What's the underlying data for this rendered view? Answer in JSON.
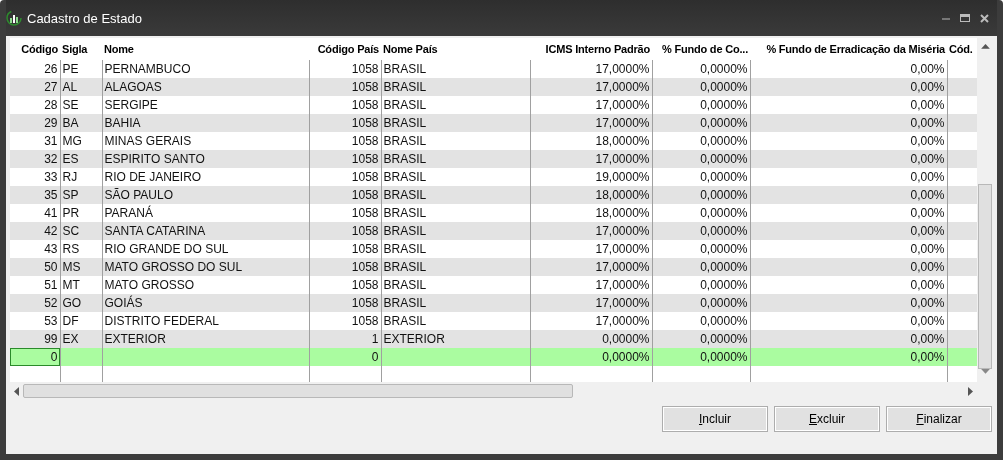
{
  "window": {
    "title": "Cadastro de Estado"
  },
  "table": {
    "columns": [
      "Código",
      "Sigla",
      "Nome",
      "Código País",
      "Nome País",
      "ICMS Interno Padrão",
      "% Fundo de Co...",
      "% Fundo de Erradicação da Miséria",
      "Cód."
    ],
    "rows": [
      {
        "cells": [
          "26",
          "PE",
          "PERNAMBUCO",
          "1058",
          "BRASIL",
          "17,0000%",
          "0,0000%",
          "0,00%"
        ],
        "selected": false
      },
      {
        "cells": [
          "27",
          "AL",
          "ALAGOAS",
          "1058",
          "BRASIL",
          "17,0000%",
          "0,0000%",
          "0,00%"
        ],
        "selected": false
      },
      {
        "cells": [
          "28",
          "SE",
          "SERGIPE",
          "1058",
          "BRASIL",
          "17,0000%",
          "0,0000%",
          "0,00%"
        ],
        "selected": false
      },
      {
        "cells": [
          "29",
          "BA",
          "BAHIA",
          "1058",
          "BRASIL",
          "17,0000%",
          "0,0000%",
          "0,00%"
        ],
        "selected": false
      },
      {
        "cells": [
          "31",
          "MG",
          "MINAS GERAIS",
          "1058",
          "BRASIL",
          "18,0000%",
          "0,0000%",
          "0,00%"
        ],
        "selected": false
      },
      {
        "cells": [
          "32",
          "ES",
          "ESPIRITO SANTO",
          "1058",
          "BRASIL",
          "17,0000%",
          "0,0000%",
          "0,00%"
        ],
        "selected": false
      },
      {
        "cells": [
          "33",
          "RJ",
          "RIO DE JANEIRO",
          "1058",
          "BRASIL",
          "19,0000%",
          "0,0000%",
          "0,00%"
        ],
        "selected": false
      },
      {
        "cells": [
          "35",
          "SP",
          "SÃO PAULO",
          "1058",
          "BRASIL",
          "18,0000%",
          "0,0000%",
          "0,00%"
        ],
        "selected": false
      },
      {
        "cells": [
          "41",
          "PR",
          "PARANÁ",
          "1058",
          "BRASIL",
          "18,0000%",
          "0,0000%",
          "0,00%"
        ],
        "selected": false
      },
      {
        "cells": [
          "42",
          "SC",
          "SANTA CATARINA",
          "1058",
          "BRASIL",
          "17,0000%",
          "0,0000%",
          "0,00%"
        ],
        "selected": false
      },
      {
        "cells": [
          "43",
          "RS",
          "RIO GRANDE DO SUL",
          "1058",
          "BRASIL",
          "17,0000%",
          "0,0000%",
          "0,00%"
        ],
        "selected": false
      },
      {
        "cells": [
          "50",
          "MS",
          "MATO GROSSO DO SUL",
          "1058",
          "BRASIL",
          "17,0000%",
          "0,0000%",
          "0,00%"
        ],
        "selected": false
      },
      {
        "cells": [
          "51",
          "MT",
          "MATO GROSSO",
          "1058",
          "BRASIL",
          "17,0000%",
          "0,0000%",
          "0,00%"
        ],
        "selected": false
      },
      {
        "cells": [
          "52",
          "GO",
          "GOIÁS",
          "1058",
          "BRASIL",
          "17,0000%",
          "0,0000%",
          "0,00%"
        ],
        "selected": false
      },
      {
        "cells": [
          "53",
          "DF",
          "DISTRITO FEDERAL",
          "1058",
          "BRASIL",
          "17,0000%",
          "0,0000%",
          "0,00%"
        ],
        "selected": false
      },
      {
        "cells": [
          "99",
          "EX",
          "EXTERIOR",
          "1",
          "EXTERIOR",
          "0,0000%",
          "0,0000%",
          "0,00%"
        ],
        "selected": false
      },
      {
        "cells": [
          "0",
          "",
          "",
          "0",
          "",
          "0,0000%",
          "0,0000%",
          "0,00%"
        ],
        "selected": true
      }
    ]
  },
  "buttons": [
    "Incluir",
    "Excluir",
    "Finalizar"
  ]
}
